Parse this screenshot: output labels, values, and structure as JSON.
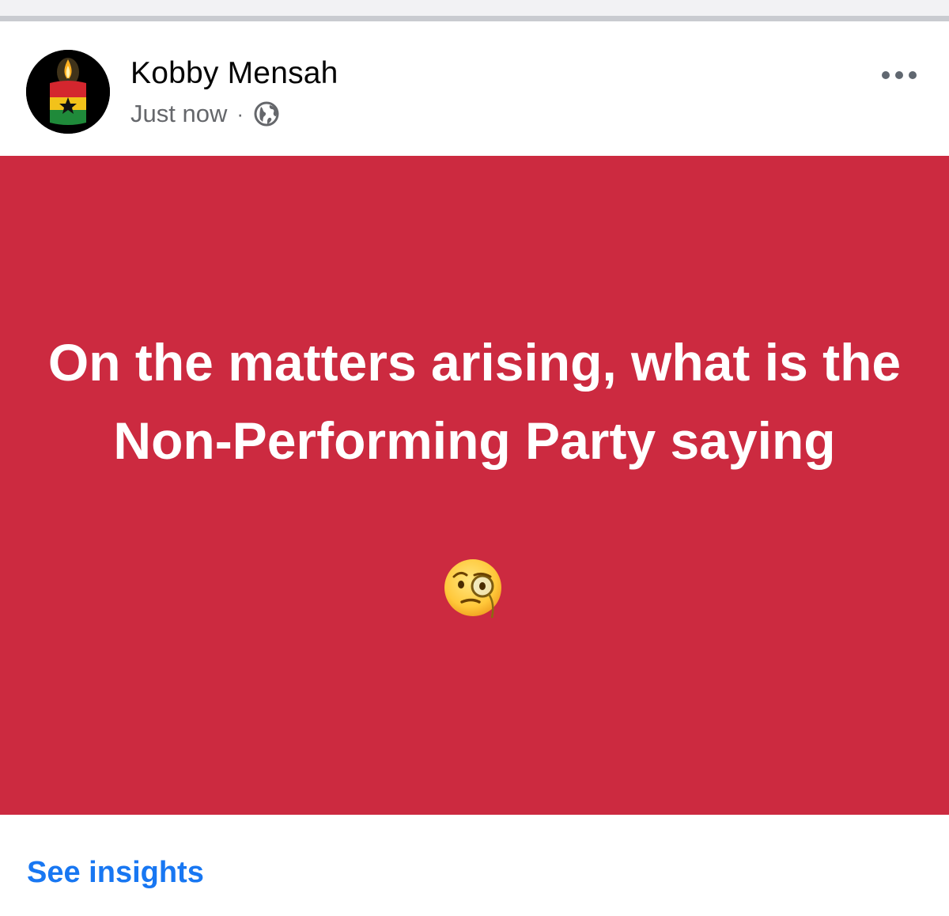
{
  "post": {
    "author": "Kobby Mensah",
    "timestamp": "Just now",
    "separator": "·",
    "privacy_icon": "globe-icon",
    "avatar_icon": "candle-ghana-flag-icon",
    "more_icon": "more-horizontal-icon",
    "text": "On the matters arising, what is the Non-Performing Party saying",
    "emoji": "face-with-monocle-emoji",
    "background_color": "#cc2a40",
    "text_color": "#ffffff"
  },
  "footer": {
    "insights_label": "See insights",
    "link_color": "#1877f2"
  }
}
